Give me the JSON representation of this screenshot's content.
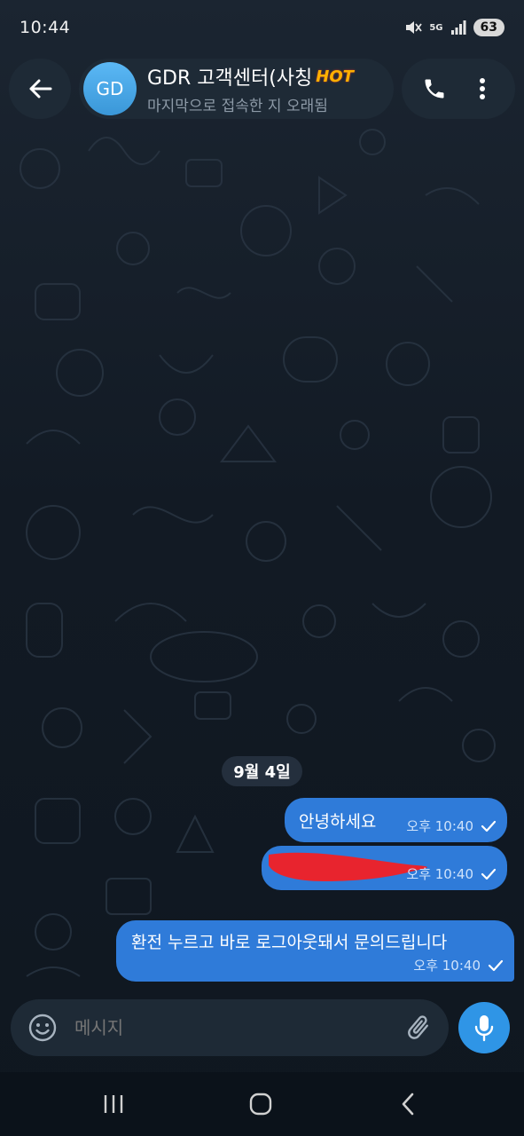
{
  "status_bar": {
    "time": "10:44",
    "network": "5G",
    "battery": "63"
  },
  "header": {
    "avatar_initials": "GD",
    "title": "GDR 고객센터(사칭",
    "badge": "HOT",
    "subtitle": "마지막으로 접속한 지 오래됨"
  },
  "chat": {
    "date_label": "9월 4일",
    "messages": [
      {
        "text": "안녕하세요",
        "time": "오후 10:40"
      },
      {
        "text": "",
        "time": "오후 10:40"
      },
      {
        "text": "환전 누르고 바로 로그아웃돼서 문의드립니다",
        "time": "오후 10:40"
      }
    ]
  },
  "composer": {
    "placeholder": "메시지"
  },
  "colors": {
    "accent": "#2f95e6",
    "bubble": "#2f7bd9",
    "background": "#0e1621",
    "redaction": "#e8242e"
  },
  "icons": [
    "back-arrow-icon",
    "phone-icon",
    "more-vert-icon",
    "emoji-icon",
    "attach-icon",
    "mic-icon",
    "recents-icon",
    "home-icon",
    "back-nav-icon"
  ]
}
